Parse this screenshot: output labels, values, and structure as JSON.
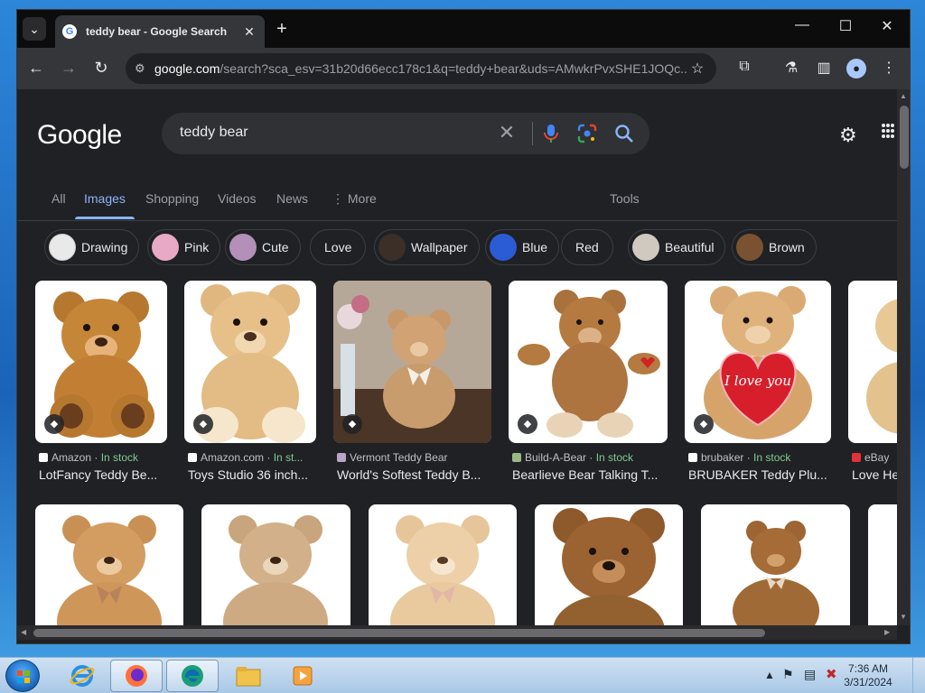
{
  "browser": {
    "tab_title": "teddy bear - Google Search",
    "new_tab": "+",
    "url_host": "google.com",
    "url_path": "/search?sca_esv=31b20d66ecc178c1&q=teddy+bear&uds=AMwkrPvxSHE1JOQc...",
    "window_controls": {
      "minimize": "—",
      "maximize": "☐",
      "close": "✕"
    }
  },
  "google": {
    "logo": "Google",
    "query": "teddy bear",
    "nav_tabs": [
      "All",
      "Images",
      "Shopping",
      "Videos",
      "News",
      "⋮ More"
    ],
    "active_tab": "Images",
    "tools": "Tools"
  },
  "chips": [
    {
      "label": "Drawing",
      "thumb": true,
      "color": "#e9e9e9"
    },
    {
      "label": "Pink",
      "thumb": true,
      "color": "#e7a9c5"
    },
    {
      "label": "Cute",
      "thumb": true,
      "color": "#b48fb7"
    },
    {
      "label": "Love",
      "thumb": false
    },
    {
      "label": "Wallpaper",
      "thumb": true,
      "color": "#3b2f27"
    },
    {
      "label": "Blue",
      "thumb": true,
      "color": "#2b5cd6"
    },
    {
      "label": "Red",
      "thumb": false
    },
    {
      "label": "Beautiful",
      "thumb": true,
      "color": "#cfc9c0"
    },
    {
      "label": "Brown",
      "thumb": true,
      "color": "#7a5232"
    }
  ],
  "results_row1": [
    {
      "source": "Amazon",
      "stock": "In stock",
      "title": "LotFancy Teddy Be..."
    },
    {
      "source": "Amazon.com",
      "stock": "In st...",
      "title": "Toys Studio 36 inch..."
    },
    {
      "source": "Vermont Teddy Bear",
      "stock": "",
      "title": "World's Softest Teddy B..."
    },
    {
      "source": "Build-A-Bear",
      "stock": "In stock",
      "title": "Bearlieve Bear Talking T..."
    },
    {
      "source": "brubaker",
      "stock": "In stock",
      "title": "BRUBAKER Teddy Plu..."
    },
    {
      "source": "eBay",
      "stock": "",
      "title": "Love He..."
    }
  ],
  "heart_text": "I love you",
  "taskbar": {
    "time": "7:36 AM",
    "date": "3/31/2024"
  },
  "colors": {
    "accent": "#8ab4f8",
    "in_stock": "#81c995",
    "page_bg": "#202124"
  }
}
